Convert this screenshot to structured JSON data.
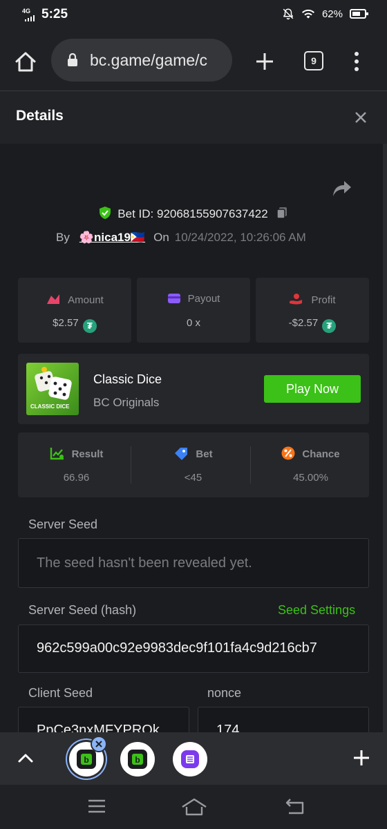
{
  "status_bar": {
    "network": "4G",
    "time": "5:25",
    "battery": "62%"
  },
  "browser": {
    "url": "bc.game/game/c",
    "tab_count": "9"
  },
  "details": {
    "title": "Details"
  },
  "bet": {
    "bet_id_label": "Bet ID:",
    "bet_id": "92068155907637422",
    "by_label": "By",
    "username": "🌸nica19🇵🇭",
    "on_label": "On",
    "datetime": "10/24/2022, 10:26:06 AM"
  },
  "stats": [
    {
      "label": "Amount",
      "value": "$2.57",
      "color": "#e8446a"
    },
    {
      "label": "Payout",
      "value": "0 x",
      "color": "#8b5cf6"
    },
    {
      "label": "Profit",
      "value": "-$2.57",
      "color": "#e0353a"
    }
  ],
  "game": {
    "name": "Classic Dice",
    "provider": "BC Originals",
    "thumb_caption": "CLASSIC DICE",
    "play_label": "Play Now"
  },
  "result_panel": {
    "result": {
      "label": "Result",
      "value": "66.96",
      "color": "#3bc117"
    },
    "bet": {
      "label": "Bet",
      "value": "<45",
      "color": "#3b82f6"
    },
    "chance": {
      "label": "Chance",
      "value": "45.00%",
      "color": "#f97316"
    }
  },
  "seeds": {
    "server_seed_label": "Server Seed",
    "server_seed_value": "The seed hasn't been revealed yet.",
    "server_hash_label": "Server Seed (hash)",
    "seed_settings": "Seed Settings",
    "server_hash_value": "962c599a00c92e9983dec9f101fa4c9d216cb7",
    "client_seed_label": "Client Seed",
    "client_seed_value": "PpCe3nxMFYPROk",
    "nonce_label": "nonce",
    "nonce_value": "174"
  },
  "colors": {
    "accent_green": "#3bc117",
    "tether_green": "#26a17b",
    "panel": "#26272b"
  }
}
